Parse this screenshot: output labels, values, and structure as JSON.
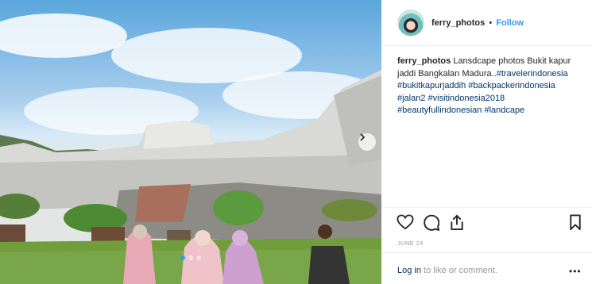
{
  "post": {
    "username": "ferry_photos",
    "separator": "•",
    "follow_label": "Follow",
    "caption_text": "Lansdcape photos Bukit kapur jaddi Bangkalan Madura..",
    "hashtags": [
      "#travelerindonesia",
      "#bukitkapurjaddih",
      "#backpackerindonesia",
      "#jalan2",
      "#visitindonesia2018",
      "#beautyfullindonesian",
      "#landcape"
    ],
    "date": "JUNE 24",
    "login_link": "Log in",
    "login_suffix": " to like or comment.",
    "more_label": "•••"
  },
  "icons": [
    "heart-icon",
    "comment-icon",
    "share-icon",
    "bookmark-icon",
    "chevron-right-icon",
    "more-options-icon"
  ],
  "carousel": {
    "slides": 3,
    "active": 1
  },
  "colors": {
    "accent": "#3897f0",
    "hashtag": "#003569",
    "muted": "#999999",
    "text": "#262626"
  }
}
